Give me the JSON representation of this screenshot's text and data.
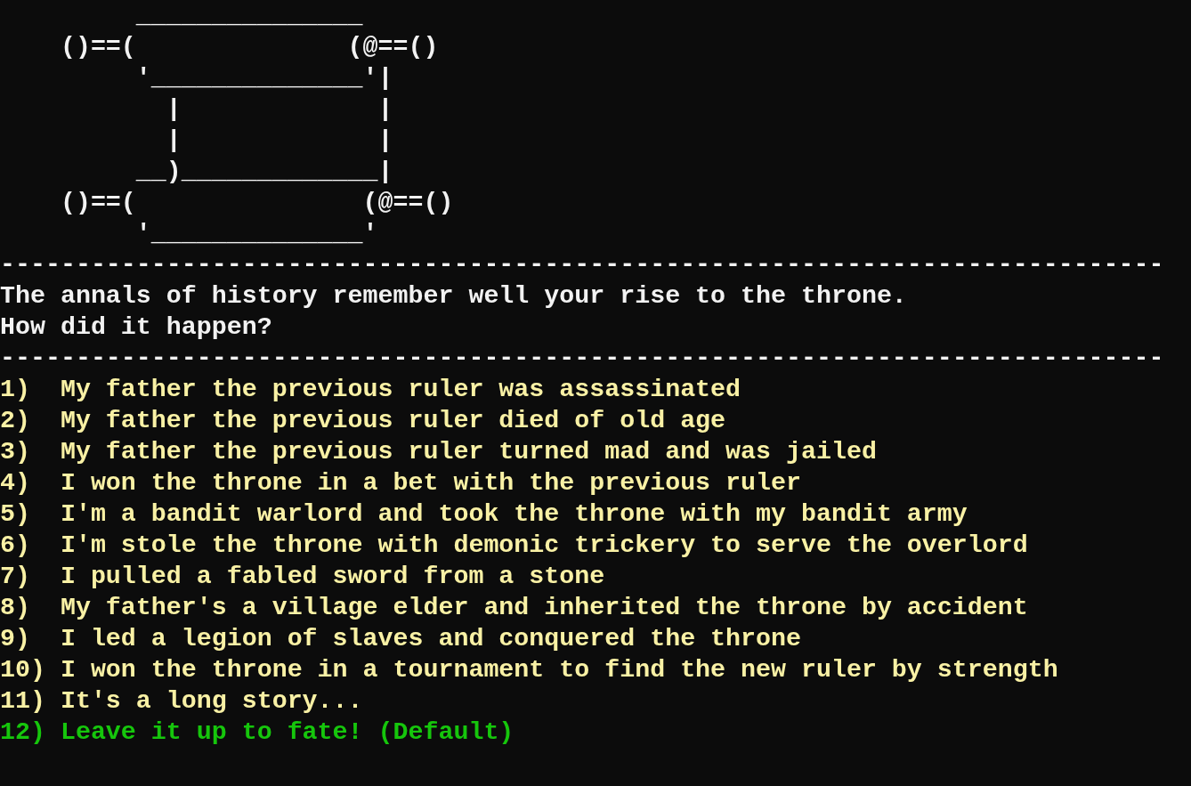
{
  "ascii_art": [
    "         _______________",
    "    ()==(              (@==()",
    "         '______________'|",
    "           |             |",
    "           |             |",
    "         __)_____________|",
    "    ()==(               (@==()",
    "         '______________'"
  ],
  "rule_top": "-----------------------------------------------------------------------------",
  "prompt": [
    "The annals of history remember well your rise to the throne.",
    "How did it happen?"
  ],
  "rule_bottom": "-----------------------------------------------------------------------------",
  "options": [
    {
      "text": "1)  My father the previous ruler was assassinated",
      "default": false
    },
    {
      "text": "2)  My father the previous ruler died of old age",
      "default": false
    },
    {
      "text": "3)  My father the previous ruler turned mad and was jailed",
      "default": false
    },
    {
      "text": "4)  I won the throne in a bet with the previous ruler",
      "default": false
    },
    {
      "text": "5)  I'm a bandit warlord and took the throne with my bandit army",
      "default": false
    },
    {
      "text": "6)  I'm stole the throne with demonic trickery to serve the overlord",
      "default": false
    },
    {
      "text": "7)  I pulled a fabled sword from a stone",
      "default": false
    },
    {
      "text": "8)  My father's a village elder and inherited the throne by accident",
      "default": false
    },
    {
      "text": "9)  I led a legion of slaves and conquered the throne",
      "default": false
    },
    {
      "text": "10) I won the throne in a tournament to find the new ruler by strength",
      "default": false
    },
    {
      "text": "11) It's a long story...",
      "default": false
    },
    {
      "text": "12) Leave it up to fate! (Default)",
      "default": true
    }
  ]
}
